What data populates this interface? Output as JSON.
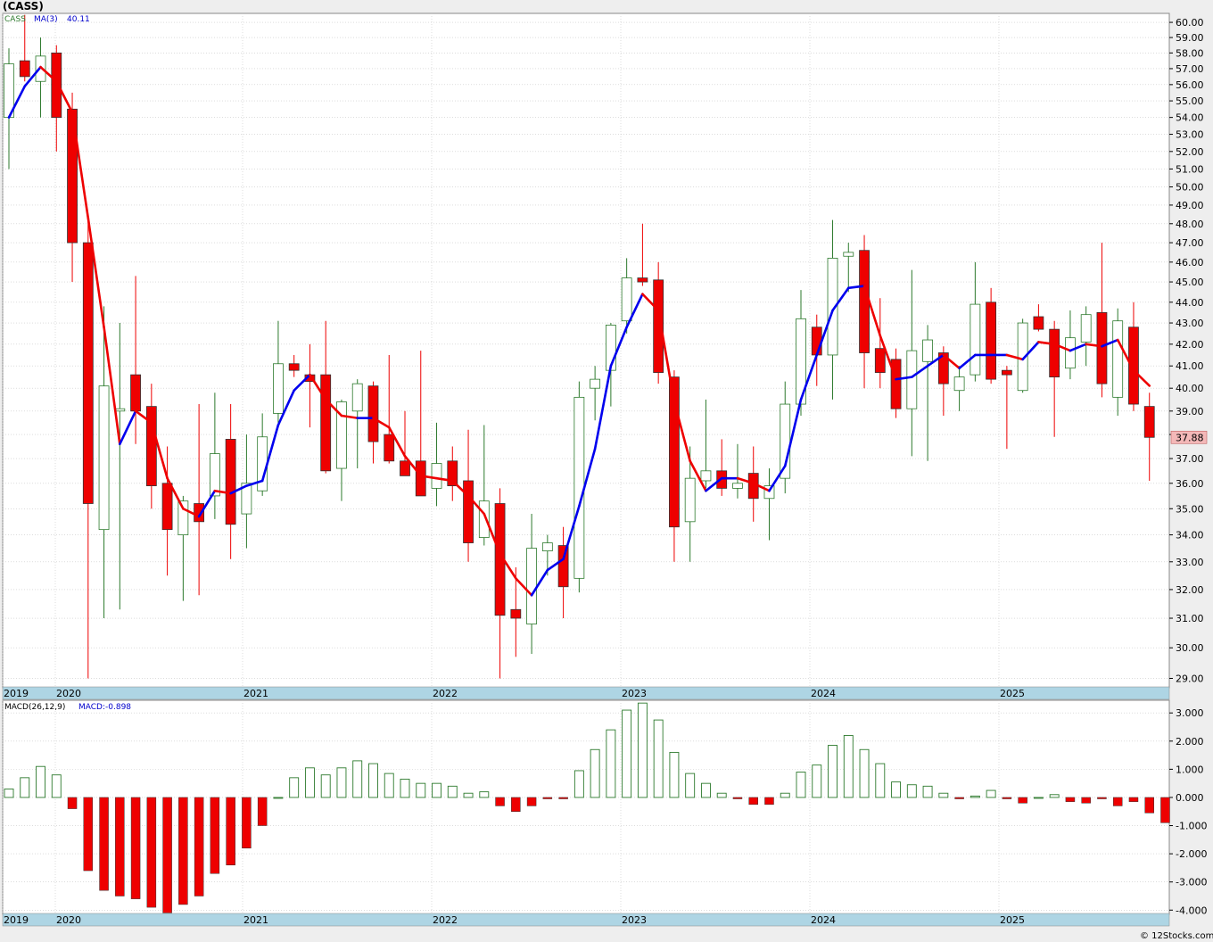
{
  "chart_data": [
    {
      "type": "candlestick",
      "title": "(CASS)",
      "legend": [
        {
          "label": "CASS",
          "color": "#2d7a2d"
        },
        {
          "label": "MA(3)",
          "color": "#0000cc"
        },
        {
          "label": "40.11",
          "color": "#0000cc"
        }
      ],
      "ylim": [
        28.7,
        60.6
      ],
      "yscale": "log",
      "yticks": [
        "29.00",
        "30.00",
        "31.00",
        "32.00",
        "33.00",
        "34.00",
        "35.00",
        "36.00",
        "37.00",
        "38.00",
        "39.00",
        "40.00",
        "41.00",
        "42.00",
        "43.00",
        "44.00",
        "45.00",
        "46.00",
        "47.00",
        "48.00",
        "49.00",
        "50.00",
        "51.00",
        "52.00",
        "53.00",
        "54.00",
        "55.00",
        "56.00",
        "57.00",
        "58.00",
        "59.00",
        "60.00"
      ],
      "xaxis_labels": [
        "2019",
        "2020",
        "2021",
        "2022",
        "2023",
        "2024",
        "2025"
      ],
      "last_price_label": "37.88",
      "up_color": "#2d7a2d",
      "down_color": "#ee0000",
      "ma_up_color": "#0000ee",
      "ma_down_color": "#ee0000",
      "candles": [
        {
          "o": 54.0,
          "h": 58.3,
          "l": 51.0,
          "c": 57.3
        },
        {
          "o": 57.5,
          "h": 60.5,
          "l": 56.2,
          "c": 56.5
        },
        {
          "o": 56.2,
          "h": 59.0,
          "l": 54.0,
          "c": 57.8
        },
        {
          "o": 58.0,
          "h": 58.5,
          "l": 52.0,
          "c": 54.0
        },
        {
          "o": 54.5,
          "h": 55.5,
          "l": 45.0,
          "c": 47.0
        },
        {
          "o": 47.0,
          "h": 48.5,
          "l": 29.0,
          "c": 35.2
        },
        {
          "o": 34.2,
          "h": 43.8,
          "l": 31.0,
          "c": 40.1
        },
        {
          "o": 39.0,
          "h": 43.0,
          "l": 31.3,
          "c": 39.1
        },
        {
          "o": 40.6,
          "h": 45.3,
          "l": 37.6,
          "c": 39.0
        },
        {
          "o": 39.2,
          "h": 40.2,
          "l": 35.0,
          "c": 35.9
        },
        {
          "o": 36.0,
          "h": 37.5,
          "l": 32.5,
          "c": 34.2
        },
        {
          "o": 34.0,
          "h": 35.5,
          "l": 31.6,
          "c": 35.3
        },
        {
          "o": 35.2,
          "h": 39.3,
          "l": 31.8,
          "c": 34.5
        },
        {
          "o": 35.5,
          "h": 39.8,
          "l": 34.6,
          "c": 37.2
        },
        {
          "o": 37.8,
          "h": 39.3,
          "l": 33.1,
          "c": 34.4
        },
        {
          "o": 34.8,
          "h": 38.0,
          "l": 33.5,
          "c": 36.0
        },
        {
          "o": 35.7,
          "h": 38.9,
          "l": 35.5,
          "c": 37.9
        },
        {
          "o": 38.9,
          "h": 43.1,
          "l": 38.5,
          "c": 41.1
        },
        {
          "o": 41.1,
          "h": 41.5,
          "l": 40.5,
          "c": 40.8
        },
        {
          "o": 40.6,
          "h": 42.0,
          "l": 38.3,
          "c": 40.3
        },
        {
          "o": 40.6,
          "h": 43.1,
          "l": 36.4,
          "c": 36.5
        },
        {
          "o": 36.6,
          "h": 39.5,
          "l": 35.3,
          "c": 39.4
        },
        {
          "o": 39.0,
          "h": 40.4,
          "l": 36.6,
          "c": 40.2
        },
        {
          "o": 40.1,
          "h": 40.3,
          "l": 36.8,
          "c": 37.7
        },
        {
          "o": 38.0,
          "h": 41.5,
          "l": 36.8,
          "c": 36.9
        },
        {
          "o": 36.9,
          "h": 39.0,
          "l": 36.7,
          "c": 36.3
        },
        {
          "o": 36.9,
          "h": 41.7,
          "l": 36.2,
          "c": 35.5
        },
        {
          "o": 35.8,
          "h": 38.5,
          "l": 35.1,
          "c": 36.8
        },
        {
          "o": 36.9,
          "h": 37.5,
          "l": 35.3,
          "c": 35.9
        },
        {
          "o": 36.1,
          "h": 38.2,
          "l": 33.0,
          "c": 33.7
        },
        {
          "o": 33.9,
          "h": 38.4,
          "l": 33.6,
          "c": 35.3
        },
        {
          "o": 35.2,
          "h": 35.8,
          "l": 29.0,
          "c": 31.1
        },
        {
          "o": 31.3,
          "h": 32.8,
          "l": 29.7,
          "c": 31.0
        },
        {
          "o": 30.8,
          "h": 34.8,
          "l": 29.8,
          "c": 33.5
        },
        {
          "o": 33.4,
          "h": 34.0,
          "l": 32.5,
          "c": 33.7
        },
        {
          "o": 33.6,
          "h": 34.3,
          "l": 31.0,
          "c": 32.1
        },
        {
          "o": 32.4,
          "h": 40.3,
          "l": 31.9,
          "c": 39.6
        },
        {
          "o": 40.0,
          "h": 41.0,
          "l": 38.6,
          "c": 40.4
        },
        {
          "o": 40.8,
          "h": 43.0,
          "l": 39.2,
          "c": 42.9
        },
        {
          "o": 43.1,
          "h": 46.2,
          "l": 42.5,
          "c": 45.2
        },
        {
          "o": 45.2,
          "h": 48.0,
          "l": 44.8,
          "c": 45.0
        },
        {
          "o": 45.1,
          "h": 46.0,
          "l": 40.2,
          "c": 40.7
        },
        {
          "o": 40.5,
          "h": 40.8,
          "l": 33.0,
          "c": 34.3
        },
        {
          "o": 34.5,
          "h": 37.5,
          "l": 33.0,
          "c": 36.2
        },
        {
          "o": 36.1,
          "h": 39.5,
          "l": 35.8,
          "c": 36.5
        },
        {
          "o": 36.5,
          "h": 37.8,
          "l": 35.5,
          "c": 35.8
        },
        {
          "o": 35.8,
          "h": 37.6,
          "l": 35.4,
          "c": 36.0
        },
        {
          "o": 36.4,
          "h": 37.5,
          "l": 34.5,
          "c": 35.4
        },
        {
          "o": 35.4,
          "h": 36.6,
          "l": 33.8,
          "c": 35.9
        },
        {
          "o": 36.2,
          "h": 40.3,
          "l": 35.6,
          "c": 39.3
        },
        {
          "o": 39.3,
          "h": 44.6,
          "l": 38.8,
          "c": 43.2
        },
        {
          "o": 42.8,
          "h": 43.4,
          "l": 40.1,
          "c": 41.5
        },
        {
          "o": 41.5,
          "h": 48.2,
          "l": 39.5,
          "c": 46.2
        },
        {
          "o": 46.3,
          "h": 47.0,
          "l": 44.5,
          "c": 46.5
        },
        {
          "o": 46.6,
          "h": 47.4,
          "l": 40.0,
          "c": 41.6
        },
        {
          "o": 41.8,
          "h": 44.2,
          "l": 40.0,
          "c": 40.7
        },
        {
          "o": 41.3,
          "h": 41.8,
          "l": 38.7,
          "c": 39.1
        },
        {
          "o": 39.1,
          "h": 45.6,
          "l": 37.1,
          "c": 41.7
        },
        {
          "o": 41.2,
          "h": 42.9,
          "l": 36.9,
          "c": 42.2
        },
        {
          "o": 41.6,
          "h": 41.9,
          "l": 38.8,
          "c": 40.2
        },
        {
          "o": 39.9,
          "h": 41.0,
          "l": 39.0,
          "c": 40.5
        },
        {
          "o": 40.6,
          "h": 46.0,
          "l": 40.3,
          "c": 43.9
        },
        {
          "o": 44.0,
          "h": 44.7,
          "l": 40.2,
          "c": 40.4
        },
        {
          "o": 40.8,
          "h": 41.0,
          "l": 37.4,
          "c": 40.6
        },
        {
          "o": 39.9,
          "h": 43.2,
          "l": 39.8,
          "c": 43.0
        },
        {
          "o": 43.3,
          "h": 43.9,
          "l": 42.6,
          "c": 42.7
        },
        {
          "o": 42.7,
          "h": 43.1,
          "l": 37.9,
          "c": 40.5
        },
        {
          "o": 40.9,
          "h": 43.6,
          "l": 40.4,
          "c": 42.3
        },
        {
          "o": 42.1,
          "h": 43.8,
          "l": 41.0,
          "c": 43.4
        },
        {
          "o": 43.5,
          "h": 47.0,
          "l": 39.6,
          "c": 40.2
        },
        {
          "o": 39.6,
          "h": 43.7,
          "l": 38.8,
          "c": 43.1
        },
        {
          "o": 42.8,
          "h": 44.0,
          "l": 39.0,
          "c": 39.3
        },
        {
          "o": 39.2,
          "h": 39.8,
          "l": 36.1,
          "c": 37.88
        }
      ],
      "ma3": [
        54.0,
        55.9,
        57.1,
        56.2,
        54.3,
        48.3,
        42.8,
        37.6,
        39.0,
        38.5,
        36.2,
        35.0,
        34.7,
        35.7,
        35.6,
        35.9,
        36.1,
        38.4,
        39.9,
        40.6,
        39.5,
        38.8,
        38.7,
        38.7,
        38.3,
        37.1,
        36.3,
        36.2,
        36.1,
        35.5,
        34.8,
        33.3,
        32.4,
        31.8,
        32.7,
        33.1,
        35.1,
        37.4,
        41.0,
        42.8,
        44.4,
        43.6,
        39.4,
        36.9,
        35.7,
        36.2,
        36.2,
        36.0,
        35.7,
        36.7,
        39.5,
        41.5,
        43.6,
        44.7,
        44.8,
        42.4,
        40.4,
        40.5,
        41.0,
        41.5,
        40.9,
        41.5,
        41.5,
        41.5,
        41.3,
        42.1,
        42.0,
        41.7,
        42.0,
        41.9,
        42.2,
        40.8,
        40.11
      ]
    },
    {
      "type": "bar",
      "title": "MACD(26,12,9)",
      "legend": [
        {
          "label": "MACD(26,12,9)",
          "color": "#000000"
        },
        {
          "label": "MACD:-0.898",
          "color": "#0000cc"
        }
      ],
      "ylim": [
        -4.15,
        3.45
      ],
      "yticks": [
        "-4.000",
        "-3.000",
        "-2.000",
        "-1.000",
        "0.000",
        "1.000",
        "2.000",
        "3.000"
      ],
      "xaxis_labels": [
        "2019",
        "2020",
        "2021",
        "2022",
        "2023",
        "2024",
        "2025"
      ],
      "up_color": "#2d7a2d",
      "down_color": "#ee0000",
      "values": [
        0.3,
        0.7,
        1.1,
        0.8,
        -0.4,
        -2.6,
        -3.3,
        -3.5,
        -3.6,
        -3.9,
        -4.1,
        -3.8,
        -3.5,
        -2.7,
        -2.4,
        -1.8,
        -1.0,
        0.0,
        0.7,
        1.05,
        0.8,
        1.05,
        1.3,
        1.2,
        0.85,
        0.65,
        0.5,
        0.5,
        0.4,
        0.15,
        0.2,
        -0.3,
        -0.5,
        -0.3,
        -0.05,
        -0.05,
        0.95,
        1.7,
        2.4,
        3.1,
        3.35,
        2.75,
        1.6,
        0.85,
        0.5,
        0.15,
        -0.05,
        -0.25,
        -0.25,
        0.15,
        0.9,
        1.15,
        1.85,
        2.2,
        1.7,
        1.2,
        0.55,
        0.45,
        0.4,
        0.15,
        -0.05,
        0.05,
        0.25,
        -0.05,
        -0.2,
        0.0,
        0.1,
        -0.15,
        -0.2,
        -0.05,
        -0.3,
        -0.15,
        -0.55,
        -0.898
      ]
    }
  ],
  "credit": "© 12Stocks.com"
}
